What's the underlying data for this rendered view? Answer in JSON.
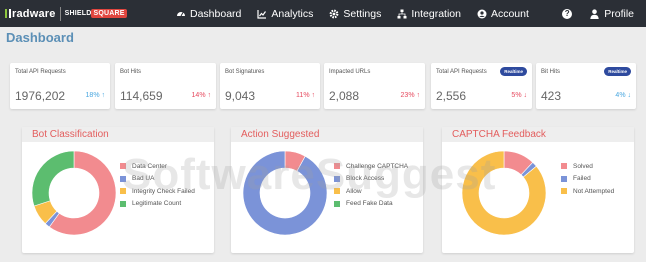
{
  "brand": {
    "radware": "radware",
    "shield_a": "SHIELD",
    "shield_b": "SQUARE"
  },
  "nav": {
    "items": [
      {
        "label": "Dashboard",
        "icon": "speedometer-icon"
      },
      {
        "label": "Analytics",
        "icon": "line-chart-icon"
      },
      {
        "label": "Settings",
        "icon": "gear-icon"
      },
      {
        "label": "Integration",
        "icon": "network-icon"
      },
      {
        "label": "Account",
        "icon": "user-circle-icon"
      }
    ],
    "help": "?",
    "profile": "Profile"
  },
  "page_title": "Dashboard",
  "stats": [
    {
      "label": "Total API Requests",
      "value": "1976,202",
      "pct": "18%",
      "dir": "up",
      "color": "blue"
    },
    {
      "label": "Bot Hits",
      "value": "114,659",
      "pct": "14%",
      "dir": "up",
      "color": "red"
    },
    {
      "label": "Bot Signatures",
      "value": "9,043",
      "pct": "11%",
      "dir": "up",
      "color": "red"
    },
    {
      "label": "Impacted URLs",
      "value": "2,088",
      "pct": "23%",
      "dir": "up",
      "color": "red"
    },
    {
      "label": "Total API Requests",
      "value": "2,556",
      "pct": "5%",
      "dir": "down",
      "color": "red",
      "badge": "Realtime"
    },
    {
      "label": "Bit Hits",
      "value": "423",
      "pct": "4%",
      "dir": "down",
      "color": "blue",
      "badge": "Realtime"
    }
  ],
  "panels": {
    "bot": {
      "title": "Bot Classification"
    },
    "action": {
      "title": "Action Suggested"
    },
    "captcha": {
      "title": "CAPTCHA Feedback"
    }
  },
  "colors": {
    "nav_bg": "#2b2f36",
    "title_blue": "#5b8fb6",
    "panel_title": "#e35d5d",
    "pink": "#f28b8f",
    "blue": "#7b93d8",
    "orange": "#f9bf4a",
    "green": "#5cbd6f"
  },
  "watermark": "SoftwareSuggest",
  "chart_data": [
    {
      "type": "pie",
      "title": "Bot Classification",
      "categories": [
        "Data Center",
        "Bad UA",
        "Integrity Check Failed",
        "Legitimate Count"
      ],
      "values": [
        60,
        2,
        8,
        30
      ],
      "colors": [
        "#f28b8f",
        "#7b93d8",
        "#f9bf4a",
        "#5cbd6f"
      ],
      "legend": "right"
    },
    {
      "type": "pie",
      "title": "Action Suggested",
      "categories": [
        "Challenge CAPTCHA",
        "Block Access",
        "Allow",
        "Feed Fake Data"
      ],
      "values": [
        8,
        92,
        0,
        0
      ],
      "colors": [
        "#f28b8f",
        "#7b93d8",
        "#f9bf4a",
        "#5cbd6f"
      ],
      "legend": "right"
    },
    {
      "type": "pie",
      "title": "CAPTCHA Feedback",
      "categories": [
        "Solved",
        "Failed",
        "Not Attempted"
      ],
      "values": [
        12,
        2,
        86
      ],
      "colors": [
        "#f28b8f",
        "#7b93d8",
        "#f9bf4a"
      ],
      "legend": "right"
    }
  ]
}
